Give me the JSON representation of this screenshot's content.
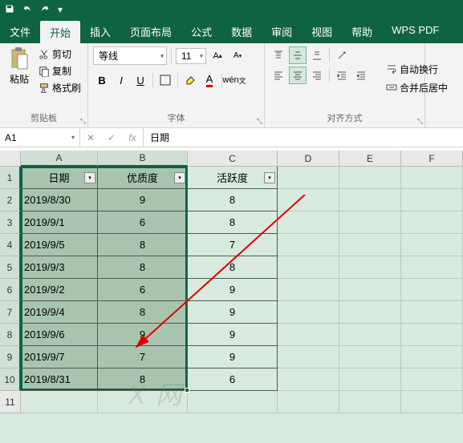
{
  "titlebar": {
    "save_tip": "保存",
    "undo_tip": "撤销",
    "redo_tip": "重做"
  },
  "tabs": {
    "file": "文件",
    "home": "开始",
    "insert": "插入",
    "page_layout": "页面布局",
    "formulas": "公式",
    "data": "数据",
    "review": "审阅",
    "view": "视图",
    "help": "帮助",
    "wps_pdf": "WPS PDF"
  },
  "ribbon": {
    "clipboard": {
      "paste": "粘贴",
      "cut": "剪切",
      "copy": "复制",
      "format_painter": "格式刷",
      "label": "剪贴板"
    },
    "font": {
      "name": "等线",
      "size": "11",
      "increase": "A",
      "decrease": "A",
      "bold": "B",
      "italic": "I",
      "underline": "U",
      "label": "字体"
    },
    "align": {
      "wrap": "自动换行",
      "merge": "合并后居中",
      "label": "对齐方式"
    }
  },
  "namebox": {
    "ref": "A1"
  },
  "formula": {
    "value": "日期"
  },
  "columns": [
    "A",
    "B",
    "C",
    "D",
    "E",
    "F"
  ],
  "table": {
    "headers": [
      "日期",
      "优质度",
      "活跃度"
    ],
    "rows": [
      {
        "date": "2019/8/30",
        "quality": "9",
        "activity": "8"
      },
      {
        "date": "2019/9/1",
        "quality": "6",
        "activity": "8"
      },
      {
        "date": "2019/9/5",
        "quality": "8",
        "activity": "7"
      },
      {
        "date": "2019/9/3",
        "quality": "8",
        "activity": "8"
      },
      {
        "date": "2019/9/2",
        "quality": "6",
        "activity": "9"
      },
      {
        "date": "2019/9/4",
        "quality": "8",
        "activity": "9"
      },
      {
        "date": "2019/9/6",
        "quality": "9",
        "activity": "9"
      },
      {
        "date": "2019/9/7",
        "quality": "7",
        "activity": "9"
      },
      {
        "date": "2019/8/31",
        "quality": "8",
        "activity": "6"
      }
    ]
  },
  "watermark": "X 网",
  "chart_data": {
    "type": "table",
    "title": "",
    "columns": [
      "日期",
      "优质度",
      "活跃度"
    ],
    "rows": [
      [
        "2019/8/30",
        9,
        8
      ],
      [
        "2019/9/1",
        6,
        8
      ],
      [
        "2019/9/5",
        8,
        7
      ],
      [
        "2019/9/3",
        8,
        8
      ],
      [
        "2019/9/2",
        6,
        9
      ],
      [
        "2019/9/4",
        8,
        9
      ],
      [
        "2019/9/6",
        9,
        9
      ],
      [
        "2019/9/7",
        7,
        9
      ],
      [
        "2019/8/31",
        8,
        6
      ]
    ]
  }
}
